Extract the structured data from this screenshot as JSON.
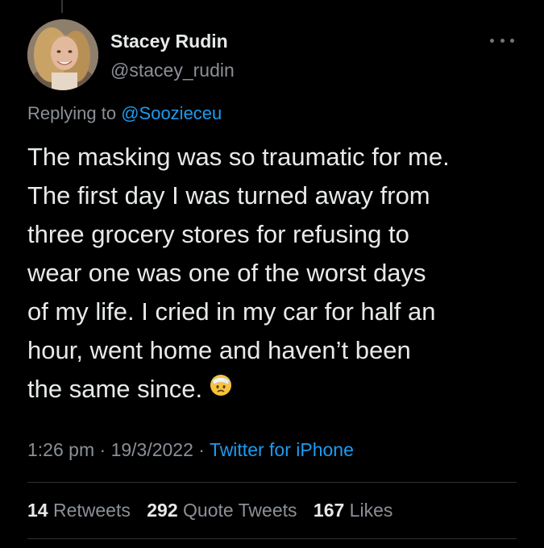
{
  "tweet": {
    "author": {
      "display_name": "Stacey Rudin",
      "handle": "@stacey_rudin",
      "avatar_icon": "profile-photo"
    },
    "more_icon": "more-horizontal-icon",
    "reply_prefix": "Replying to",
    "reply_to": "@Soozieceu",
    "text_lines": [
      "The masking was so traumatic for me.",
      "The first day I was turned away from",
      "three grocery stores for refusing to",
      "wear one was one of the worst days",
      "of my life. I cried in my car for half an",
      "hour, went home and haven’t been",
      "the same since."
    ],
    "emoji_icon": "face-with-head-bandage-emoji",
    "time": "1:26 pm",
    "separator": " · ",
    "date": "19/3/2022",
    "source": "Twitter for iPhone",
    "stats": {
      "retweets_count": "14",
      "retweets_label": "Retweets",
      "quotes_count": "292",
      "quotes_label": "Quote Tweets",
      "likes_count": "167",
      "likes_label": "Likes"
    }
  },
  "colors": {
    "background": "#000000",
    "text_primary": "#e7e9ea",
    "text_secondary": "#8b9096",
    "accent": "#1d9bf0",
    "divider": "#2f3336"
  }
}
